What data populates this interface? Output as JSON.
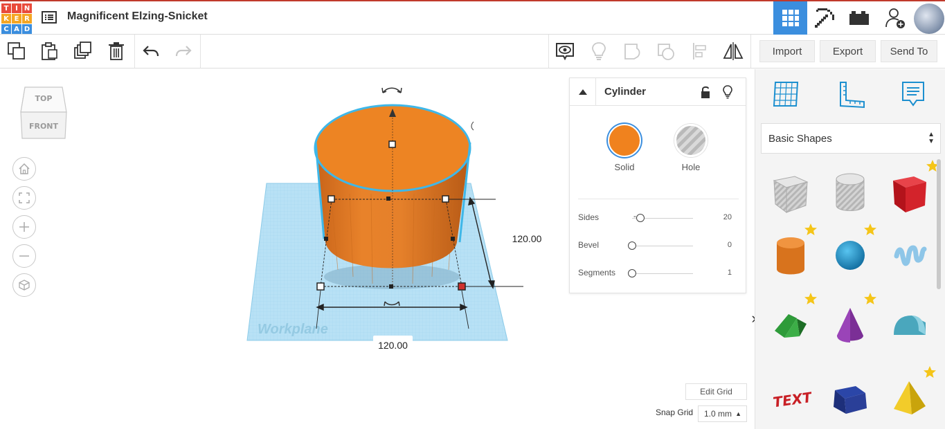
{
  "app": {
    "logo_letters": [
      "T",
      "I",
      "N",
      "K",
      "E",
      "R",
      "C",
      "A",
      "D"
    ],
    "logo_colors": [
      "#e94b3c",
      "#e94b3c",
      "#e94b3c",
      "#f5a623",
      "#f5a623",
      "#f5a623",
      "#3b8ede",
      "#3b8ede",
      "#3b8ede"
    ],
    "design_title": "Magnificent Elzing-Snicket",
    "accent": "#3b8ede"
  },
  "header": {
    "views": [
      {
        "name": "grid-view-icon",
        "active": true
      },
      {
        "name": "pickaxe-icon",
        "active": false
      },
      {
        "name": "bricks-icon",
        "active": false
      }
    ],
    "user_icon": "user-add-icon"
  },
  "toolbar": {
    "left_tools": [
      "copy-icon",
      "paste-icon",
      "duplicate-icon",
      "delete-icon",
      "undo-icon",
      "redo-icon"
    ],
    "right_tools": [
      "show-all-icon",
      "notes-icon",
      "group-icon",
      "ungroup-icon",
      "align-icon",
      "mirror-icon"
    ],
    "import_label": "Import",
    "export_label": "Export",
    "send_to_label": "Send To"
  },
  "viewcube": {
    "top_label": "TOP",
    "front_label": "FRONT"
  },
  "nav": [
    "home-icon",
    "fit-view-icon",
    "zoom-in-icon",
    "zoom-out-icon",
    "perspective-icon"
  ],
  "scene": {
    "workplane_label": "Workplane",
    "height_value": "120.00",
    "width_value": "120.00",
    "shape_color": "#e8822a",
    "selection_color": "#3fb7e8"
  },
  "inspector": {
    "title": "Cylinder",
    "modes": [
      {
        "label": "Solid",
        "selected": true,
        "color": "#f0821e"
      },
      {
        "label": "Hole",
        "selected": false
      }
    ],
    "props": [
      {
        "label": "Sides",
        "value": "20",
        "level": 0.14
      },
      {
        "label": "Bevel",
        "value": "0",
        "level": 0
      },
      {
        "label": "Segments",
        "value": "1",
        "level": 0
      }
    ]
  },
  "grid_controls": {
    "edit_grid_label": "Edit Grid",
    "snap_label": "Snap Grid",
    "snap_value": "1.0 mm"
  },
  "right_panel": {
    "tabs": [
      "workplane-icon",
      "ruler-icon",
      "notes-icon"
    ],
    "category": "Basic Shapes",
    "shapes": [
      {
        "name": "box-hole",
        "fav": false
      },
      {
        "name": "cylinder-hole",
        "fav": false
      },
      {
        "name": "box",
        "fav": true
      },
      {
        "name": "cylinder",
        "fav": true
      },
      {
        "name": "sphere",
        "fav": true
      },
      {
        "name": "scribble",
        "fav": false
      },
      {
        "name": "roof",
        "fav": true
      },
      {
        "name": "cone",
        "fav": true
      },
      {
        "name": "round-roof",
        "fav": false
      },
      {
        "name": "text",
        "fav": false
      },
      {
        "name": "wedge",
        "fav": false
      },
      {
        "name": "pyramid",
        "fav": true
      }
    ],
    "text_shape_label": "TEXT"
  }
}
